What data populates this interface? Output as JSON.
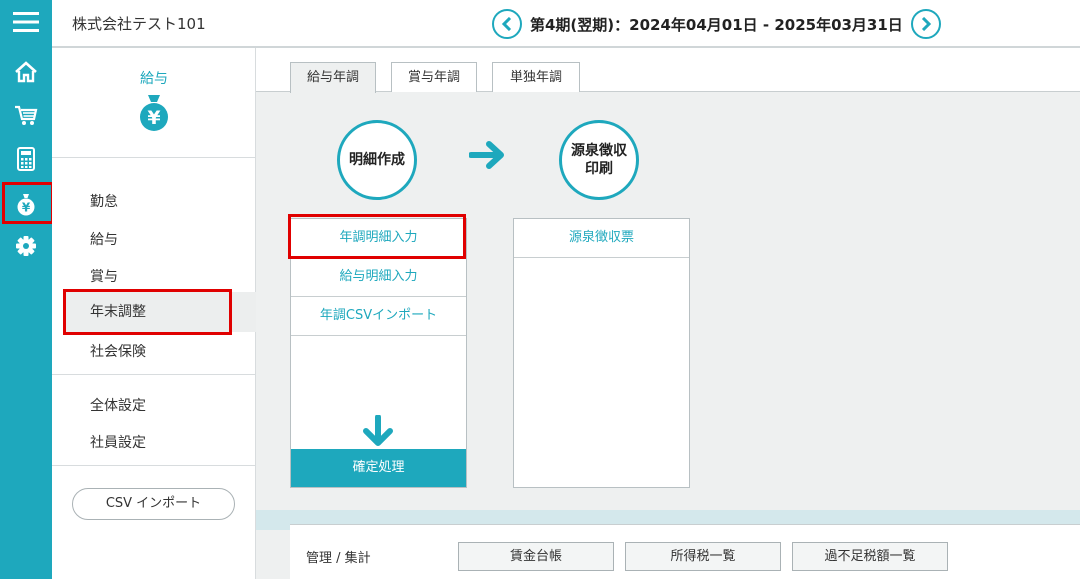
{
  "rail": {
    "items": [
      {
        "icon": "menu-icon"
      },
      {
        "icon": "home-icon"
      },
      {
        "icon": "cart-icon"
      },
      {
        "icon": "calculator-icon"
      },
      {
        "icon": "money-bag-icon"
      },
      {
        "icon": "gear-icon"
      }
    ],
    "active_index": 4
  },
  "header": {
    "company": "株式会社テスト101",
    "period": "第4期(翌期)：2024年04月01日 - 2025年03月31日"
  },
  "side": {
    "title": "給与",
    "icon": "money-bag-icon",
    "group1": [
      "勤怠",
      "給与",
      "賞与",
      "年末調整",
      "社会保険"
    ],
    "group2": [
      "全体設定",
      "社員設定"
    ],
    "active": "年末調整",
    "csv_button": "CSV インポート"
  },
  "main": {
    "tabs": [
      "給与年調",
      "賞与年調",
      "単独年調"
    ],
    "active_tab": 0,
    "step1": {
      "title": "明細作成",
      "items": [
        "年調明細入力",
        "給与明細入力",
        "年調CSVインポート"
      ],
      "confirm": "確定処理"
    },
    "step2": {
      "title": "源泉徴収印刷",
      "items": [
        "源泉徴収票"
      ]
    },
    "mgmt": {
      "label": "管理 / 集計",
      "buttons": [
        "賃金台帳",
        "所得税一覧",
        "過不足税額一覧"
      ]
    }
  },
  "colors": {
    "accent": "#1ea8bd",
    "highlight": "#e00000",
    "panel_bg": "#eef0f0"
  }
}
